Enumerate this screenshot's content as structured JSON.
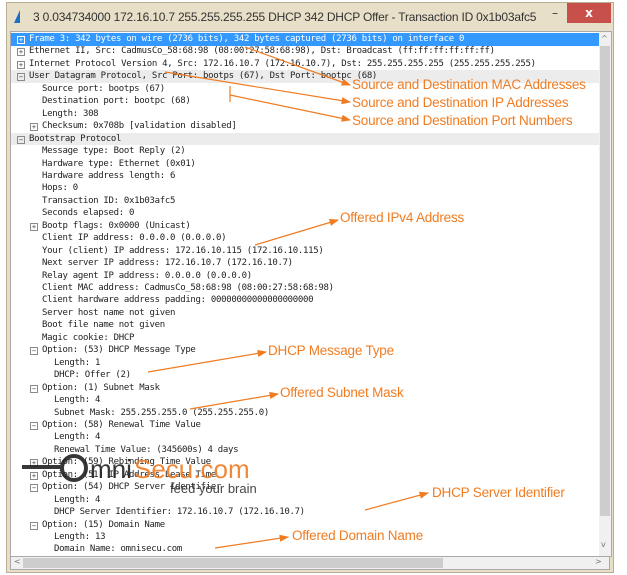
{
  "window": {
    "title": "3 0.034734000 172.16.10.7 255.255.255.255 DHCP 342 DHCP Offer   - Transaction ID 0x1b03afc5",
    "minimize": "–",
    "close": "x"
  },
  "colors": {
    "selection": "#3399ff",
    "annotation": "#f07c22",
    "close_button": "#c7504a"
  },
  "rows": [
    {
      "level": 0,
      "exp": "plus",
      "text": "Frame 3: 342 bytes on wire (2736 bits), 342 bytes captured (2736 bits) on interface 0",
      "selected": true
    },
    {
      "level": 0,
      "exp": "plus",
      "text": "Ethernet II, Src: CadmusCo_58:68:98 (08:00:27:58:68:98), Dst: Broadcast (ff:ff:ff:ff:ff:ff)"
    },
    {
      "level": 0,
      "exp": "plus",
      "text": "Internet Protocol Version 4, Src: 172.16.10.7 (172.16.10.7), Dst: 255.255.255.255 (255.255.255.255)"
    },
    {
      "level": 0,
      "exp": "minus",
      "text": "User Datagram Protocol, Src Port: bootps (67), Dst Port: bootpc (68)",
      "shade": true
    },
    {
      "level": 1,
      "text": "Source port: bootps (67)"
    },
    {
      "level": 1,
      "text": "Destination port: bootpc (68)"
    },
    {
      "level": 1,
      "text": "Length: 308"
    },
    {
      "level": 1,
      "exp": "plus",
      "text": "Checksum: 0x708b [validation disabled]"
    },
    {
      "level": 0,
      "exp": "minus",
      "text": "Bootstrap Protocol",
      "shade": true
    },
    {
      "level": 1,
      "text": "Message type: Boot Reply (2)"
    },
    {
      "level": 1,
      "text": "Hardware type: Ethernet (0x01)"
    },
    {
      "level": 1,
      "text": "Hardware address length: 6"
    },
    {
      "level": 1,
      "text": "Hops: 0"
    },
    {
      "level": 1,
      "text": "Transaction ID: 0x1b03afc5"
    },
    {
      "level": 1,
      "text": "Seconds elapsed: 0"
    },
    {
      "level": 1,
      "exp": "plus",
      "text": "Bootp flags: 0x0000 (Unicast)"
    },
    {
      "level": 1,
      "text": "Client IP address: 0.0.0.0 (0.0.0.0)"
    },
    {
      "level": 1,
      "text": "Your (client) IP address: 172.16.10.115 (172.16.10.115)"
    },
    {
      "level": 1,
      "text": "Next server IP address: 172.16.10.7 (172.16.10.7)"
    },
    {
      "level": 1,
      "text": "Relay agent IP address: 0.0.0.0 (0.0.0.0)"
    },
    {
      "level": 1,
      "text": "Client MAC address: CadmusCo_58:68:98 (08:00:27:58:68:98)"
    },
    {
      "level": 1,
      "text": "Client hardware address padding: 00000000000000000000"
    },
    {
      "level": 1,
      "text": "Server host name not given"
    },
    {
      "level": 1,
      "text": "Boot file name not given"
    },
    {
      "level": 1,
      "text": "Magic cookie: DHCP"
    },
    {
      "level": 1,
      "exp": "minus",
      "text": "Option: (53) DHCP Message Type"
    },
    {
      "level": 2,
      "text": "Length: 1"
    },
    {
      "level": 2,
      "text": "DHCP: Offer (2)"
    },
    {
      "level": 1,
      "exp": "minus",
      "text": "Option: (1) Subnet Mask"
    },
    {
      "level": 2,
      "text": "Length: 4"
    },
    {
      "level": 2,
      "text": "Subnet Mask: 255.255.255.0 (255.255.255.0)"
    },
    {
      "level": 1,
      "exp": "minus",
      "text": "Option: (58) Renewal Time Value"
    },
    {
      "level": 2,
      "text": "Length: 4"
    },
    {
      "level": 2,
      "text": "Renewal Time Value: (345600s) 4 days"
    },
    {
      "level": 1,
      "exp": "plus",
      "text": "Option: (59) Rebinding Time Value"
    },
    {
      "level": 1,
      "exp": "plus",
      "text": "Option: (51) IP Address Lease Time"
    },
    {
      "level": 1,
      "exp": "minus",
      "text": "Option: (54) DHCP Server Identifier"
    },
    {
      "level": 2,
      "text": "Length: 4"
    },
    {
      "level": 2,
      "text": "DHCP Server Identifier: 172.16.10.7 (172.16.10.7)"
    },
    {
      "level": 1,
      "exp": "minus",
      "text": "Option: (15) Domain Name"
    },
    {
      "level": 2,
      "text": "Length: 13"
    },
    {
      "level": 2,
      "text": "Domain Name: omnisecu.com"
    }
  ],
  "annotations": {
    "mac": "Source and Destination MAC Addresses",
    "ip": "Source and Destination IP Addresses",
    "port": "Source and Destination Port Numbers",
    "ipv4": "Offered IPv4 Address",
    "msgtype": "DHCP Message Type",
    "subnet": "Offered Subnet Mask",
    "serverid": "DHCP Server Identifier",
    "domain": "Offered Domain Name"
  },
  "watermark": {
    "brand": "OmniSecu.com",
    "tagline": "feed your brain"
  }
}
